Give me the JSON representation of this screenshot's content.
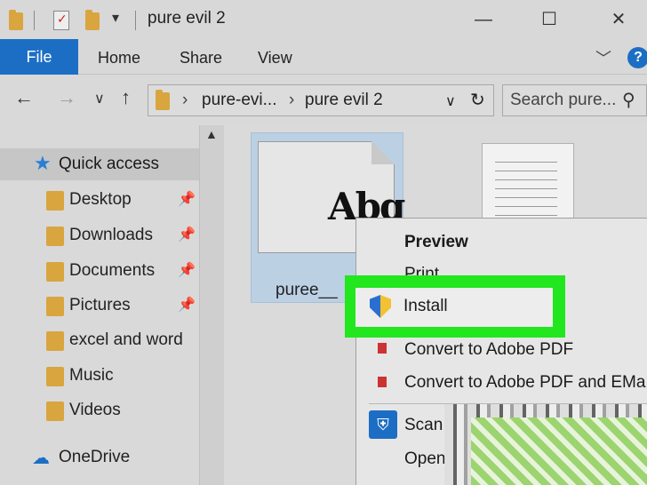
{
  "titlebar": {
    "title": "pure evil 2",
    "qa_dropdown": "▾",
    "minimize": "—",
    "maximize": "☐",
    "close": "✕"
  },
  "ribbon": {
    "file": "File",
    "tabs": [
      "Home",
      "Share",
      "View"
    ],
    "help": "?"
  },
  "address": {
    "crumbs": [
      "pure-evi...",
      "pure evil 2"
    ],
    "search_placeholder": "Search pure..."
  },
  "navpane": {
    "quick_access": "Quick access",
    "items": [
      {
        "label": "Desktop",
        "pinned": true
      },
      {
        "label": "Downloads",
        "pinned": true
      },
      {
        "label": "Documents",
        "pinned": true
      },
      {
        "label": "Pictures",
        "pinned": true
      },
      {
        "label": "excel and word",
        "pinned": false
      },
      {
        "label": "Music",
        "pinned": false
      },
      {
        "label": "Videos",
        "pinned": false
      }
    ],
    "onedrive": "OneDrive"
  },
  "files": [
    {
      "name": "puree__",
      "thumbnail_text": "Abg",
      "selected": true
    },
    {
      "name": "",
      "selected": false
    }
  ],
  "context_menu": {
    "preview": "Preview",
    "print": "Print",
    "install": "Install",
    "convert_pdf": "Convert to Adobe PDF",
    "convert_pdf_email": "Convert to Adobe PDF and EMa",
    "scan": "Scan",
    "open": "Open"
  },
  "colors": {
    "highlight": "#22e61e",
    "accent": "#1c6ec4",
    "selection": "#bcd0e3"
  }
}
